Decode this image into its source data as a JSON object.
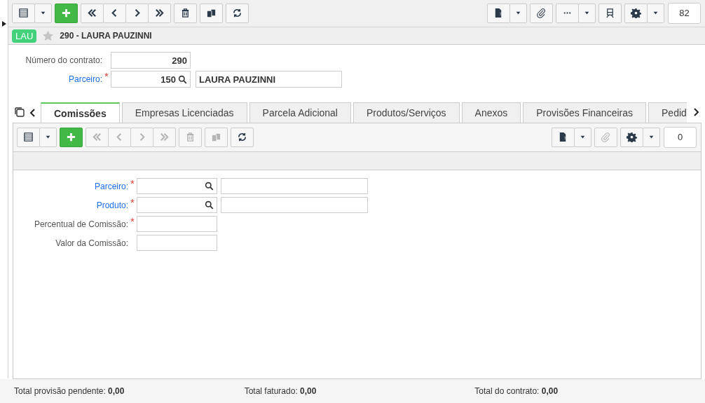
{
  "toolbar": {
    "left": [
      [
        {
          "kind": "grid",
          "disabled": false
        },
        {
          "kind": "caret",
          "disabled": false
        }
      ],
      [
        {
          "kind": "add",
          "disabled": false
        }
      ],
      [
        {
          "kind": "first",
          "disabled": false
        },
        {
          "kind": "prev",
          "disabled": false
        },
        {
          "kind": "next",
          "disabled": false
        },
        {
          "kind": "last",
          "disabled": false
        }
      ],
      [
        {
          "kind": "delete",
          "disabled": false
        }
      ],
      [
        {
          "kind": "copy",
          "disabled": false
        }
      ],
      [
        {
          "kind": "refresh",
          "disabled": false
        }
      ]
    ],
    "right": [
      [
        {
          "kind": "export",
          "disabled": false
        },
        {
          "kind": "caret",
          "disabled": false
        }
      ],
      [
        {
          "kind": "clip",
          "disabled": false
        }
      ],
      [
        {
          "kind": "more",
          "disabled": false
        },
        {
          "kind": "caret",
          "disabled": false
        }
      ],
      [
        {
          "kind": "train",
          "disabled": false
        }
      ],
      [
        {
          "kind": "gear",
          "disabled": false
        },
        {
          "kind": "caret",
          "disabled": false
        }
      ]
    ],
    "counter": "82"
  },
  "record": {
    "badge": "LAU",
    "favorite": false,
    "title": "290 - LAURA PAUZINNI"
  },
  "form": [
    {
      "label": "Número do contrato:",
      "link": false,
      "value": "290",
      "lookup": false
    },
    {
      "label": "Parceiro:",
      "link": true,
      "required_mark": "*",
      "value": "150",
      "lookup": true,
      "description": "LAURA PAUZINNI"
    }
  ],
  "tabs": [
    {
      "label": "Comissões",
      "selected": true
    },
    {
      "label": "Empresas Licenciadas",
      "selected": false
    },
    {
      "label": "Parcela Adicional",
      "selected": false
    },
    {
      "label": "Produtos/Serviços",
      "selected": false
    },
    {
      "label": "Anexos",
      "selected": false
    },
    {
      "label": "Provisões Financeiras",
      "selected": false
    },
    {
      "label": "Pedid",
      "selected": false
    }
  ],
  "subpanel": {
    "toolbar": {
      "left": [
        [
          {
            "kind": "grid",
            "disabled": false
          },
          {
            "kind": "caret",
            "disabled": false
          }
        ],
        [
          {
            "kind": "add",
            "disabled": false
          }
        ],
        [
          {
            "kind": "first",
            "disabled": true
          },
          {
            "kind": "prev",
            "disabled": true
          },
          {
            "kind": "next",
            "disabled": true
          },
          {
            "kind": "last",
            "disabled": true
          }
        ],
        [
          {
            "kind": "delete",
            "disabled": true
          }
        ],
        [
          {
            "kind": "copy",
            "disabled": true
          }
        ],
        [
          {
            "kind": "refresh",
            "disabled": false
          }
        ]
      ],
      "right": [
        [
          {
            "kind": "export",
            "disabled": false
          },
          {
            "kind": "caret",
            "disabled": false
          }
        ],
        [
          {
            "kind": "clip",
            "disabled": true
          }
        ],
        [
          {
            "kind": "gear",
            "disabled": false
          },
          {
            "kind": "caret",
            "disabled": false
          }
        ]
      ],
      "counter": "0"
    },
    "form": [
      {
        "label": "Parceiro:",
        "link": true,
        "required_mark": "*",
        "lookup": true,
        "description_field": true
      },
      {
        "label": "Produto:",
        "link": true,
        "required_mark": "*",
        "lookup": true,
        "description_field": true
      },
      {
        "label": "Percentual de Comissão:",
        "link": false,
        "required_mark": "*",
        "lookup": false
      },
      {
        "label": "Valor da Comissão:",
        "link": false,
        "lookup": false
      }
    ]
  },
  "footer": [
    "Total provisão pendente: **0,00**",
    "Total faturado: **0,00**",
    "Total do contrato: **0,00**"
  ]
}
